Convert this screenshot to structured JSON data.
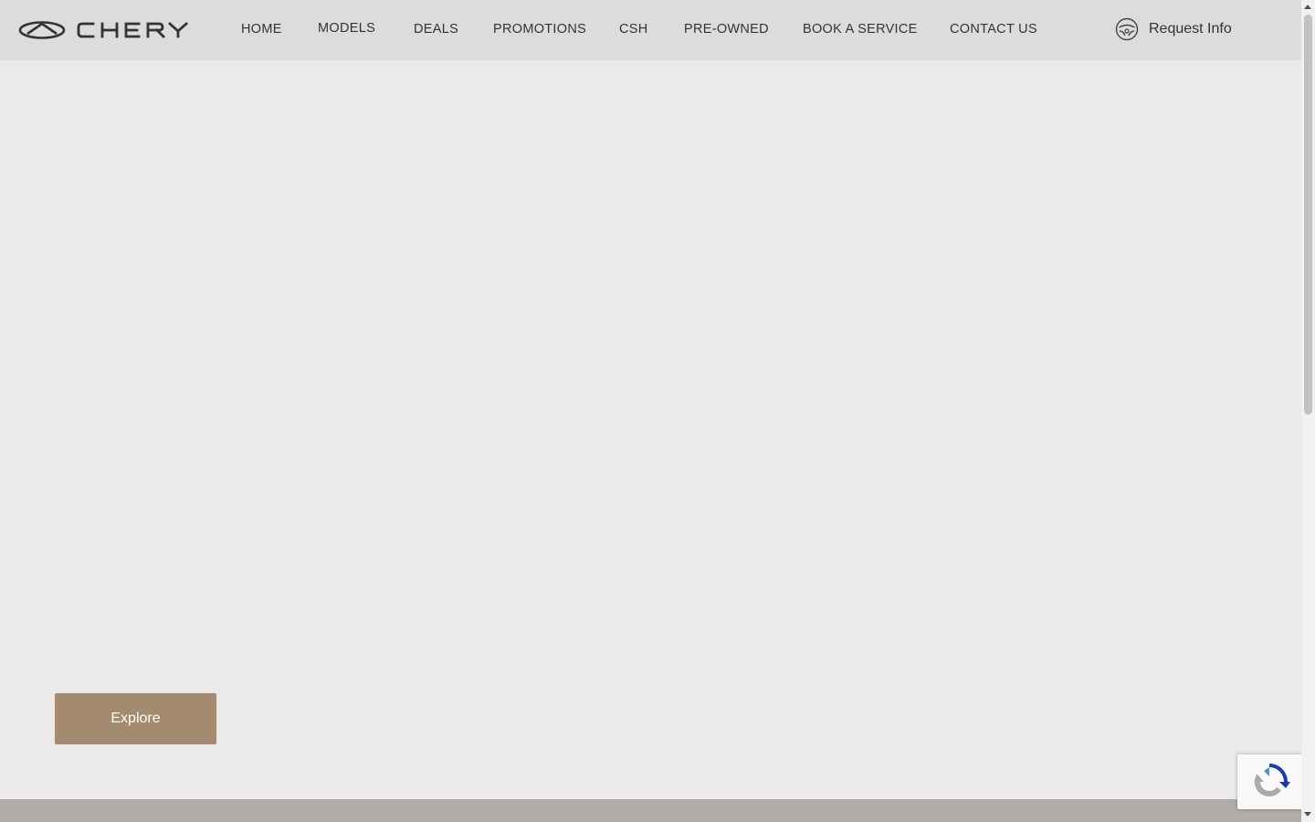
{
  "brand": {
    "name": "CHERY"
  },
  "nav": {
    "items": [
      {
        "label": "HOME"
      },
      {
        "label": "MODELS"
      },
      {
        "label": "DEALS"
      },
      {
        "label": "PROMOTIONS"
      },
      {
        "label": "CSH"
      },
      {
        "label": "PRE-OWNED"
      },
      {
        "label": "BOOK A SERVICE"
      },
      {
        "label": "CONTACT US"
      }
    ],
    "request_label": "Request Info",
    "request_icon": "steering-wheel-icon"
  },
  "hero": {
    "cta_label": "Explore"
  },
  "colors": {
    "header_bg": "#dddcda",
    "hero_bg": "#ebeae8",
    "accent": "#a48a6e",
    "footer_strip": "#b1acaa"
  }
}
